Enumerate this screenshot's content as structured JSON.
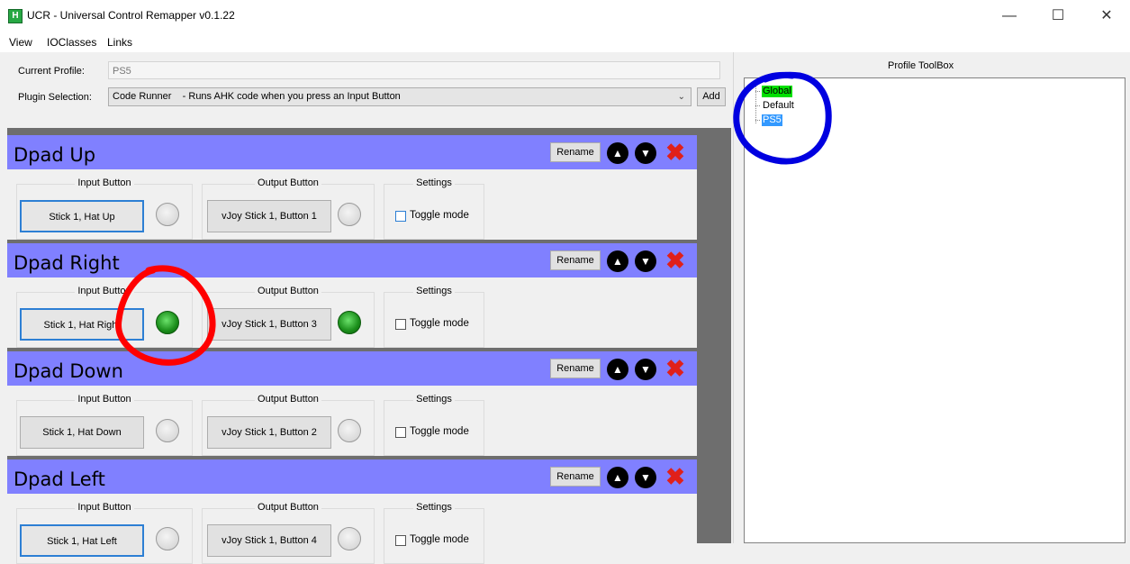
{
  "window": {
    "title": "UCR - Universal Control Remapper v0.1.22",
    "icon_letter": "H",
    "controls": {
      "minimize": "—",
      "maximize": "☐",
      "close": "✕"
    }
  },
  "menu": [
    "View",
    "IOClasses",
    "Links"
  ],
  "profile": {
    "current_profile_label": "Current Profile:",
    "current_profile_value": "PS5",
    "plugin_selection_label": "Plugin Selection:",
    "plugin_selection_value": "Code Runner    - Runs AHK code when you press an Input Button",
    "add_label": "Add"
  },
  "bindings": [
    {
      "title": "Dpad Up",
      "input": "Stick 1, Hat Up",
      "output": "vJoy Stick 1, Button 1",
      "input_active": false,
      "output_active": false
    },
    {
      "title": "Dpad Right",
      "input": "Stick 1, Hat Right",
      "output": "vJoy Stick 1, Button 3",
      "input_active": true,
      "output_active": true
    },
    {
      "title": "Dpad Down",
      "input": "Stick 1, Hat Down",
      "output": "vJoy Stick 1, Button 2",
      "input_active": false,
      "output_active": false
    },
    {
      "title": "Dpad Left",
      "input": "Stick 1, Hat Left",
      "output": "vJoy Stick 1, Button 4",
      "input_active": false,
      "output_active": false
    }
  ],
  "binding_labels": {
    "rename": "Rename",
    "input_group": "Input Button",
    "output_group": "Output Button",
    "settings_group": "Settings",
    "toggle_mode": "Toggle mode",
    "up_arrow": "⌃",
    "down_arrow": "⌄",
    "delete": "✖"
  },
  "toolbox": {
    "title": "Profile ToolBox",
    "items": [
      {
        "label": "Global",
        "state": "highlighted"
      },
      {
        "label": "Default",
        "state": "normal"
      },
      {
        "label": "PS5",
        "state": "selected"
      }
    ]
  },
  "colors": {
    "binding_header": "#8080ff",
    "led_on": "#1a8d1a",
    "global_highlight": "#00e000",
    "selected_item": "#3399ff",
    "annotation_red": "#ff0000",
    "annotation_blue": "#0000e0"
  }
}
